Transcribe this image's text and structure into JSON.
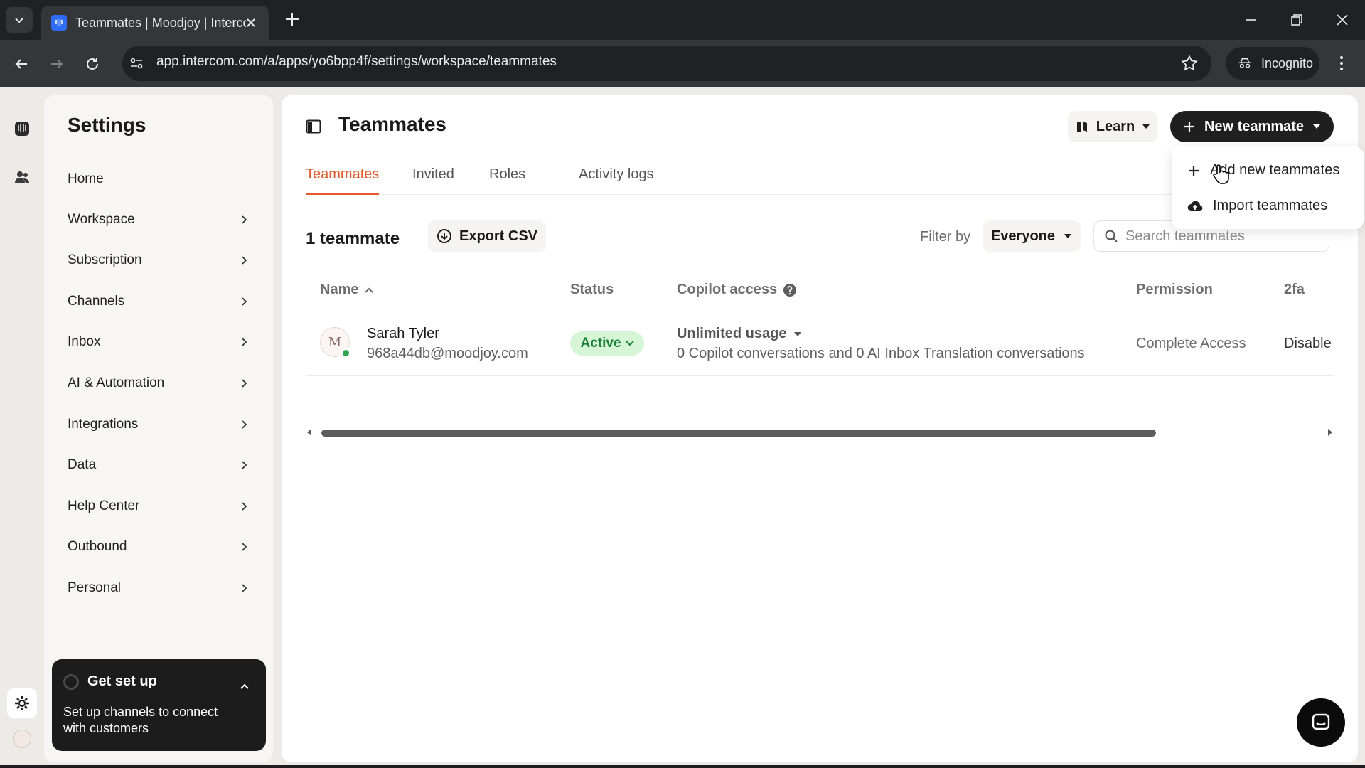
{
  "browser": {
    "tab_title": "Teammates | Moodjoy | Interco",
    "url": "app.intercom.com/a/apps/yo6bpp4f/settings/workspace/teammates",
    "incognito_label": "Incognito"
  },
  "sidebar": {
    "title": "Settings",
    "items": [
      {
        "label": "Home",
        "has_chevron": false
      },
      {
        "label": "Workspace",
        "has_chevron": true
      },
      {
        "label": "Subscription",
        "has_chevron": true
      },
      {
        "label": "Channels",
        "has_chevron": true
      },
      {
        "label": "Inbox",
        "has_chevron": true
      },
      {
        "label": "AI & Automation",
        "has_chevron": true
      },
      {
        "label": "Integrations",
        "has_chevron": true
      },
      {
        "label": "Data",
        "has_chevron": true
      },
      {
        "label": "Help Center",
        "has_chevron": true
      },
      {
        "label": "Outbound",
        "has_chevron": true
      },
      {
        "label": "Personal",
        "has_chevron": true
      }
    ],
    "setup": {
      "title": "Get set up",
      "description": "Set up channels to connect with customers"
    }
  },
  "header": {
    "title": "Teammates",
    "learn_label": "Learn",
    "new_teammate_label": "New teammate"
  },
  "tabs": [
    "Teammates",
    "Invited",
    "Roles",
    "Activity logs"
  ],
  "toolbar": {
    "count_label": "1 teammate",
    "export_label": "Export CSV",
    "filter_label": "Filter by",
    "filter_value": "Everyone",
    "search_placeholder": "Search teammates"
  },
  "table": {
    "columns": {
      "name": "Name",
      "status": "Status",
      "copilot": "Copilot access",
      "permission": "Permission",
      "twofa": "2fa"
    },
    "rows": [
      {
        "name": "Sarah Tyler",
        "email": "968a44db@moodjoy.com",
        "avatar_letter": "M",
        "status": "Active",
        "copilot_plan": "Unlimited usage",
        "copilot_desc": "0 Copilot conversations and 0 AI Inbox Translation conversations",
        "permission": "Complete Access",
        "twofa": "Disable"
      }
    ]
  },
  "dropdown_menu": {
    "items": [
      {
        "label": "Add new teammates",
        "icon": "plus-icon"
      },
      {
        "label": "Import teammates",
        "icon": "cloud-upload-icon"
      }
    ]
  },
  "colors": {
    "accent_orange": "#e05a2b",
    "active_green": "#1a7f37",
    "active_bg": "#d6f5d6",
    "dark_button": "#1f1f1f"
  }
}
